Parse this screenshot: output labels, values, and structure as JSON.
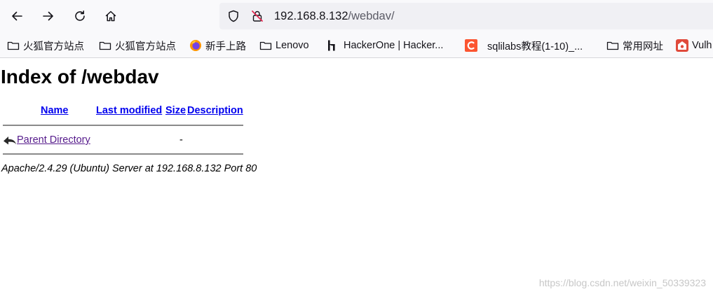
{
  "browser": {
    "url_host": "192.168.8.132",
    "url_path": "/webdav/"
  },
  "bookmarks": [
    {
      "label": "火狐官方站点",
      "icon": "folder-icon"
    },
    {
      "label": "火狐官方站点",
      "icon": "folder-icon"
    },
    {
      "label": "新手上路",
      "icon": "firefox-icon"
    },
    {
      "label": "Lenovo",
      "icon": "folder-icon"
    },
    {
      "label": "HackerOne | Hacker...",
      "icon": "hackerone-icon"
    },
    {
      "label": "sqlilabs教程(1-10)_...",
      "icon": "csdn-icon"
    },
    {
      "label": "常用网址",
      "icon": "folder-icon"
    },
    {
      "label": "Vulh",
      "icon": "vulhub-icon"
    }
  ],
  "page": {
    "heading": "Index of /webdav",
    "columns": {
      "name": "Name",
      "last_modified": "Last modified",
      "size": "Size",
      "description": "Description"
    },
    "rows": [
      {
        "name": "Parent Directory",
        "last_modified": "",
        "size": "-",
        "description": "",
        "icon": "back-arrow-icon"
      }
    ],
    "address": "Apache/2.4.29 (Ubuntu) Server at 192.168.8.132 Port 80",
    "watermark": "https://blog.csdn.net/weixin_50339323"
  },
  "colors": {
    "link": "#0000ee",
    "visited_link": "#551a8b",
    "toolbar_bg": "#f9f9fb",
    "urlbar_bg": "#f0f0f4",
    "csdn_red": "#fc5531",
    "vulhub_red": "#e04a3b"
  }
}
